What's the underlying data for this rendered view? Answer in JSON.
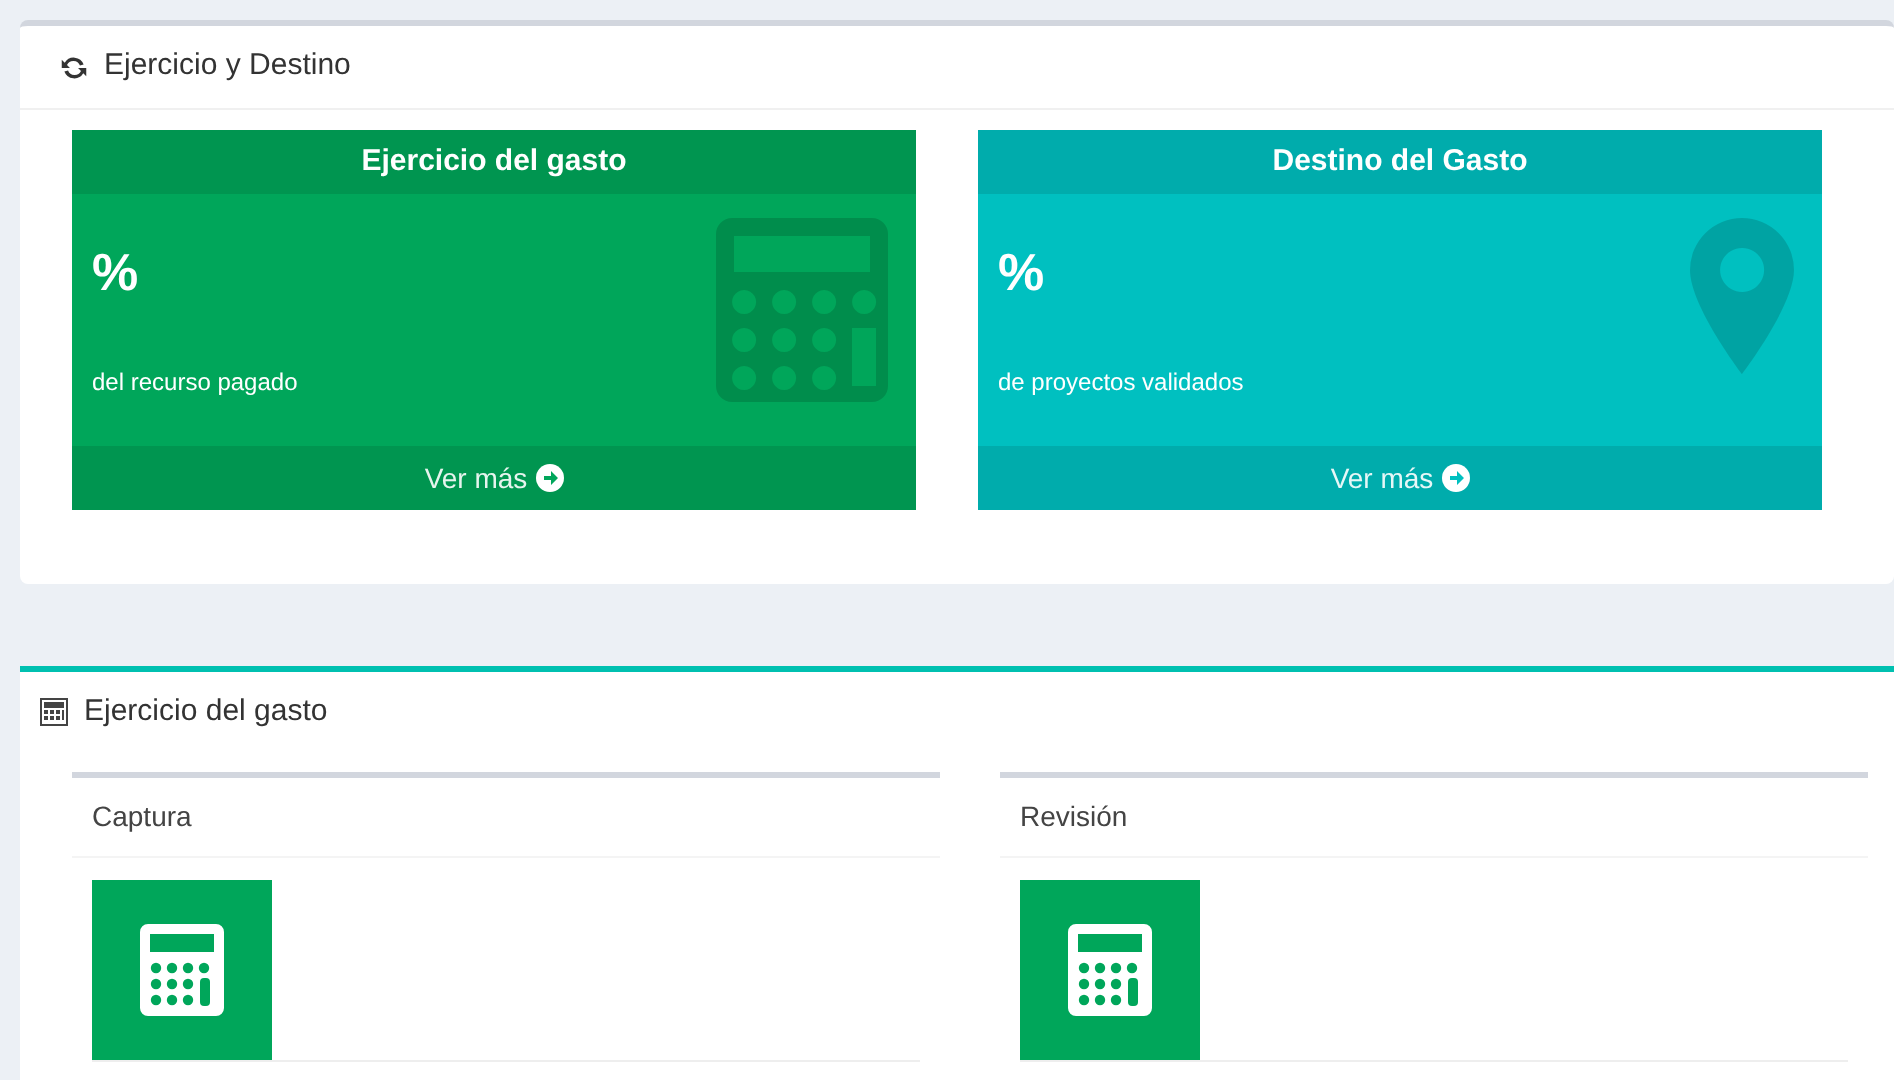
{
  "summary_panel": {
    "title": "Ejercicio y Destino",
    "cards": [
      {
        "title": "Ejercicio del gasto",
        "value": "%",
        "caption": "del recurso pagado",
        "link": "Ver más",
        "kind": "calculator",
        "color": "#00a65a"
      },
      {
        "title": "Destino del Gasto",
        "value": "%",
        "caption": "de proyectos validados",
        "link": "Ver más",
        "kind": "location",
        "color": "#00c0c0"
      }
    ]
  },
  "spending_panel": {
    "title": "Ejercicio del gasto",
    "boxes": [
      {
        "title": "Captura",
        "kind": "calculator"
      },
      {
        "title": "Revisión",
        "kind": "calculator"
      }
    ]
  }
}
